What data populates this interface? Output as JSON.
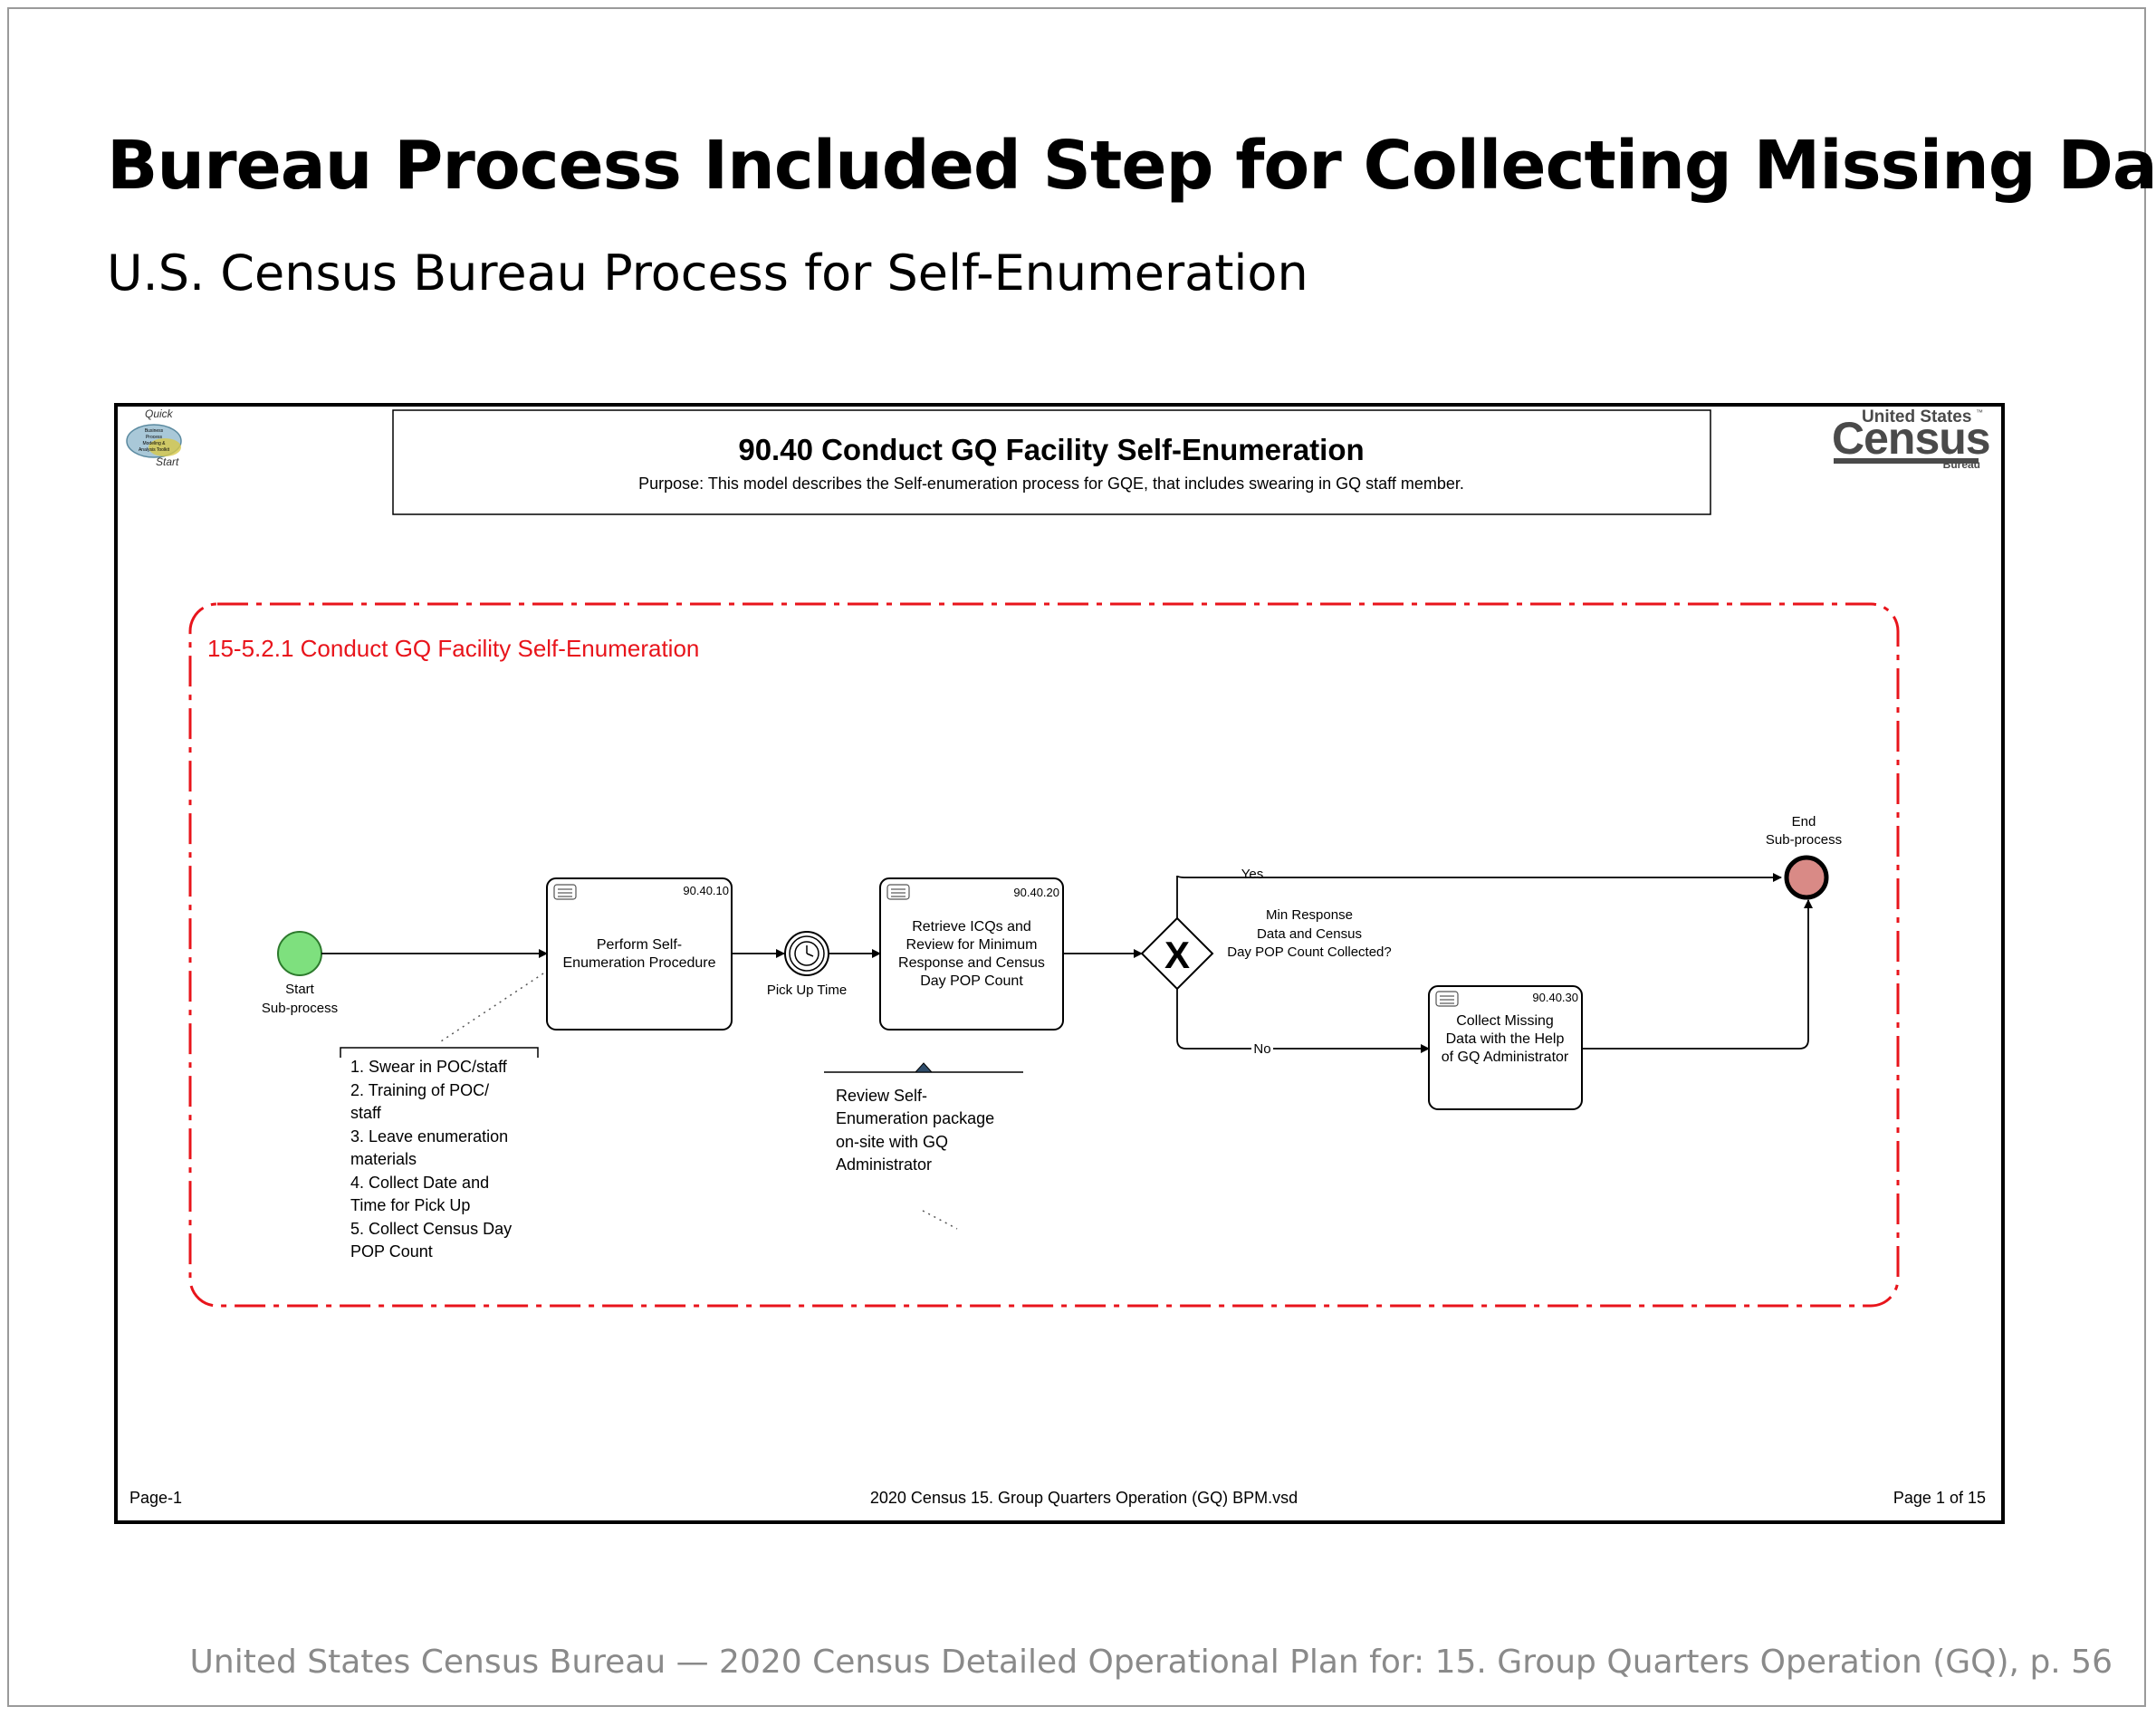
{
  "slide": {
    "title": "Bureau Process Included Step for Collecting Missing Data",
    "subtitle": "U.S. Census Bureau Process for Self-Enumeration",
    "footer": "United States Census Bureau — 2020  Census  Detailed Operational Plan for: 15. Group Quarters  Operation (GQ), p. 56"
  },
  "diagram": {
    "title": "90.40 Conduct GQ Facility Self-Enumeration",
    "purpose": "Purpose: This model describes the Self-enumeration process for GQE, that includes swearing in GQ staff member.",
    "logo": {
      "top": "United States",
      "main": "Census",
      "bottom": "Bureau",
      "tm": "™"
    },
    "quickstart": {
      "top": "Quick",
      "lines": [
        "Business",
        "Process",
        "Modeling &",
        "Analysis Toolkit"
      ],
      "bottom": "Start"
    },
    "subprocess_label": "15-5.2.1 Conduct GQ Facility Self-Enumeration",
    "start_event": {
      "line1": "Start",
      "line2": "Sub-process"
    },
    "end_event": {
      "line1": "End",
      "line2": "Sub-process"
    },
    "timer_label": "Pick Up Time",
    "gateway": {
      "symbol": "X",
      "question": [
        "Min Response",
        "Data and Census",
        "Day POP Count Collected?"
      ],
      "yes": "Yes",
      "no": "No"
    },
    "tasks": [
      {
        "id": "90.40.10",
        "lines": [
          "Perform Self-",
          "Enumeration Procedure"
        ]
      },
      {
        "id": "90.40.20",
        "lines": [
          "Retrieve ICQs and",
          "Review for Minimum",
          "Response and Census",
          "Day POP Count"
        ]
      },
      {
        "id": "90.40.30",
        "lines": [
          "Collect Missing",
          "Data with the Help",
          "of GQ Administrator"
        ]
      }
    ],
    "annotation_1": [
      "1. Swear in POC/staff",
      "2. Training of POC/",
      "staff",
      "3. Leave enumeration",
      "materials",
      "4. Collect Date and",
      "Time for Pick Up",
      "5. Collect Census Day",
      "POP Count"
    ],
    "annotation_2": [
      "Review Self-",
      "Enumeration package",
      "on-site with GQ",
      "Administrator"
    ],
    "page_left": "Page-1",
    "page_center": "2020 Census 15. Group Quarters Operation (GQ) BPM.vsd",
    "page_right": "Page 1 of 15",
    "colors": {
      "subprocess_border": "#e8141b",
      "start_fill": "#7ee07e",
      "end_fill": "#d98a86",
      "logo": "#4a4a4a"
    }
  }
}
